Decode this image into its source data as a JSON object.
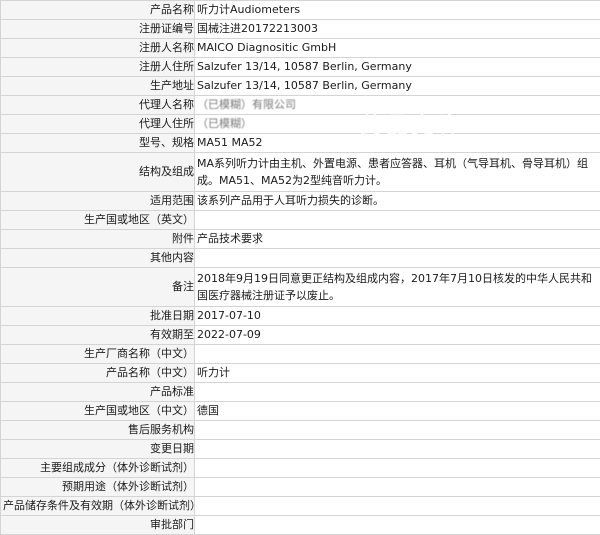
{
  "rows": [
    {
      "key": "产品名称",
      "value": "听力计Audiometers"
    },
    {
      "key": "注册证编号",
      "value": "国械注进20172213003"
    },
    {
      "key": "注册人名称",
      "value": "MAICO Diagnositic GmbH"
    },
    {
      "key": "注册人住所",
      "value": "Salzufer 13/14, 10587 Berlin, Germany"
    },
    {
      "key": "生产地址",
      "value": "Salzufer 13/14, 10587 Berlin, Germany"
    },
    {
      "key": "代理人名称",
      "value": "（已模糊）有限公司"
    },
    {
      "key": "代理人住所",
      "value": "（已模糊）"
    },
    {
      "key": "型号、规格",
      "value": "MA51 MA52"
    },
    {
      "key": "结构及组成",
      "value": "MA系列听力计由主机、外置电源、患者应答器、耳机（气导耳机、骨导耳机）组成。MA51、MA52为2型纯音听力计。"
    },
    {
      "key": "适用范围",
      "value": "该系列产品用于人耳听力损失的诊断。"
    },
    {
      "key": "生产国或地区（英文）",
      "value": ""
    },
    {
      "key": "附件",
      "value": "产品技术要求"
    },
    {
      "key": "其他内容",
      "value": ""
    },
    {
      "key": "备注",
      "value": "2018年9月19日同意更正结构及组成内容，2017年7月10日核发的中华人民共和国医疗器械注册证予以废止。"
    },
    {
      "key": "批准日期",
      "value": "2017-07-10"
    },
    {
      "key": "有效期至",
      "value": "2022-07-09"
    },
    {
      "key": "生产厂商名称（中文）",
      "value": ""
    },
    {
      "key": "产品名称（中文）",
      "value": "听力计"
    },
    {
      "key": "产品标准",
      "value": ""
    },
    {
      "key": "生产国或地区（中文）",
      "value": "德国"
    },
    {
      "key": "售后服务机构",
      "value": ""
    },
    {
      "key": "变更日期",
      "value": ""
    },
    {
      "key": "主要组成成分（体外诊断试剂）",
      "value": ""
    },
    {
      "key": "预期用途（体外诊断试剂）",
      "value": ""
    },
    {
      "key": "产品储存条件及有效期（体外诊断试剂）",
      "value": ""
    },
    {
      "key": "审批部门",
      "value": ""
    }
  ],
  "watermark": "药品允许"
}
